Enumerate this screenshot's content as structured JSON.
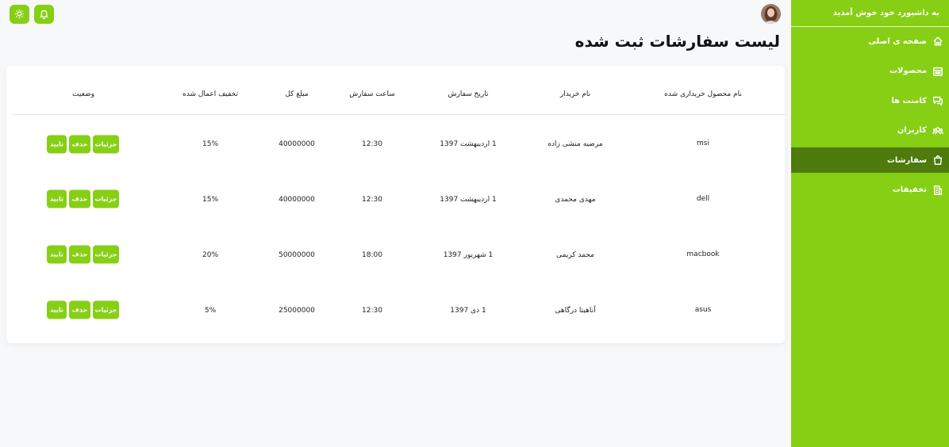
{
  "sidebar": {
    "welcome": "به داشبورد خود خوش آمدید",
    "items": [
      {
        "label": "صفحه ی اصلی",
        "icon": "home-icon"
      },
      {
        "label": "محصولات",
        "icon": "products-icon"
      },
      {
        "label": "کامنت ها",
        "icon": "comments-icon"
      },
      {
        "label": "کاربران",
        "icon": "users-icon"
      },
      {
        "label": "سفارشات",
        "icon": "orders-bag-icon",
        "active": true
      },
      {
        "label": "تخفیفات",
        "icon": "discounts-icon"
      }
    ]
  },
  "topbar": {
    "theme_icon": "sun-icon",
    "notification_icon": "bell-icon",
    "avatar": "user-avatar"
  },
  "page": {
    "title": "لیست سفارشات ثبت شده"
  },
  "table": {
    "headers": {
      "product": "نام محصول خریداری شده",
      "buyer": "نام خریدار",
      "date": "تاریخ سفارش",
      "time": "ساعت سفارش",
      "total": "مبلغ کل",
      "discount": "تخفیف اعمال شده",
      "status": "وضعیت"
    },
    "rows": [
      {
        "product": "msi",
        "buyer": "مرضیه منشی زاده",
        "date": "1 اردیبهشت 1397",
        "time": "12:30",
        "total": "40000000",
        "discount": "15%"
      },
      {
        "product": "dell",
        "buyer": "مهدی محمدی",
        "date": "1 اردیبهشت 1397",
        "time": "12:30",
        "total": "40000000",
        "discount": "15%"
      },
      {
        "product": "macbook",
        "buyer": "محمد کریمی",
        "date": "1 شهریور 1397",
        "time": "18:00",
        "total": "50000000",
        "discount": "20%"
      },
      {
        "product": "asus",
        "buyer": "آناهیتا درگاهی",
        "date": "1 دی 1397",
        "time": "12:30",
        "total": "25000000",
        "discount": "5%"
      }
    ],
    "actions": {
      "details": "جزئیات",
      "delete": "حذف",
      "confirm": "تایید"
    }
  },
  "colors": {
    "accent": "#86cf15",
    "active": "#4e7a0e",
    "background": "#f7f8fa"
  }
}
